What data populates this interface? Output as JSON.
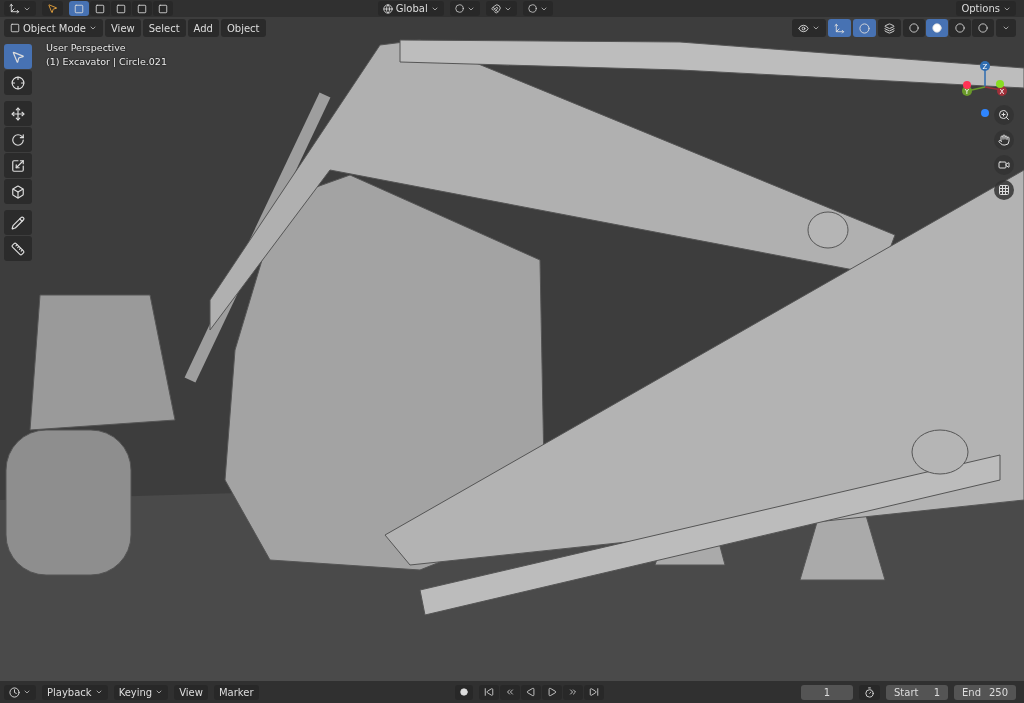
{
  "top_bar": {
    "select_modes": [
      {
        "selected": true
      },
      {
        "selected": false
      },
      {
        "selected": false
      },
      {
        "selected": false
      },
      {
        "selected": false
      }
    ],
    "orientation": "Global",
    "options": "Options"
  },
  "viewport_header": {
    "mode": "Object Mode",
    "menus": [
      "View",
      "Select",
      "Add",
      "Object"
    ],
    "shading_modes": [
      {
        "selected": false
      },
      {
        "selected": true
      },
      {
        "selected": false
      },
      {
        "selected": false
      }
    ]
  },
  "overlay_text": {
    "view": "User Perspective",
    "object": "(1) Excavator | Circle.021"
  },
  "tools": [
    {
      "kind": "select",
      "selected": true
    },
    {
      "kind": "cursor",
      "selected": false
    },
    {
      "kind": "move",
      "selected": false
    },
    {
      "kind": "rotate",
      "selected": false
    },
    {
      "kind": "scale",
      "selected": false
    },
    {
      "kind": "transform",
      "selected": false
    },
    {
      "kind": "annotate",
      "selected": false
    },
    {
      "kind": "measure",
      "selected": false
    }
  ],
  "gizmo": {
    "axes": [
      "Z",
      "Y",
      "X"
    ]
  },
  "timeline": {
    "menus": [
      "Playback",
      "Keying",
      "View",
      "Marker"
    ],
    "current_frame": "1",
    "start_label": "Start",
    "start": "1",
    "end_label": "End",
    "end": "250"
  }
}
